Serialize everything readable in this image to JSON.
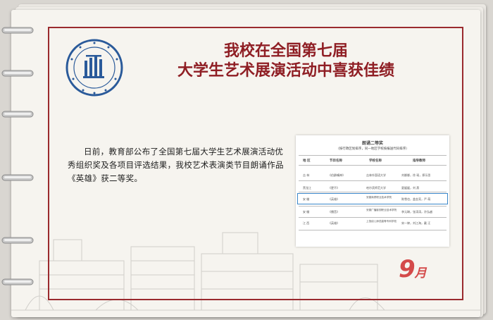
{
  "header": {
    "title_line1": "我校在全国第七届",
    "title_line2": "大学生艺术展演活动中喜获佳绩"
  },
  "body": {
    "paragraph": "日前，教育部公布了全国第七届大学生艺术展演活动优秀组织奖及各项目评选结果，我校艺术表演类节目朗诵作品《英雄》获二等奖。"
  },
  "document": {
    "title": "朗诵二等奖",
    "subtitle": "（按行政区划排序，同一地区学校按报送代码排序）",
    "headers": [
      "地 区",
      "节目名称",
      "学校名称",
      "指导教师"
    ],
    "rows": [
      [
        "吉 林",
        "《伯爵嘴神》",
        "吉林外国语大学",
        "刘娜娜，徐 瑶，郑乐思"
      ],
      [
        "黑龙江",
        "《更不》",
        "哈尔滨师范大学",
        "夏媛媛，刘 燕"
      ],
      [
        "安 徽",
        "《英雄》",
        "安徽商贸职业技术学院",
        "陈雪也，盖金亮，严 萌"
      ],
      [
        "安 徽",
        "《播音》",
        "安徽广播影视职业技术学院",
        "李元琳，张涛涛，孙弘越"
      ],
      [
        "江 西",
        "《英雄》",
        "上饶幼儿师范高等专科学校",
        "宋一婷，刘江海，戴 汪"
      ]
    ]
  },
  "calendar": {
    "month_number": "9",
    "month_char": "月"
  },
  "colors": {
    "accent": "#8f1e24",
    "frame": "#9a2a2e",
    "month": "#d44a4a",
    "highlight": "#3a86c8"
  },
  "icons": [
    "ring-binder-icon",
    "school-seal-logo"
  ]
}
